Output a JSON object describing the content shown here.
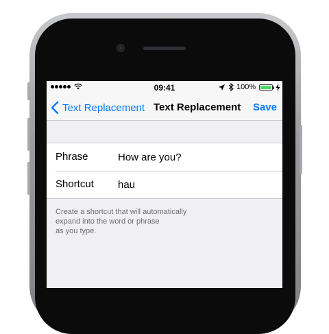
{
  "status_bar": {
    "time": "09:41",
    "battery_percent": "100%",
    "signal_bars": 5,
    "battery_level": 1.0,
    "icons": [
      "signal-dots-icon",
      "wifi-icon",
      "location-arrow-icon",
      "bluetooth-icon",
      "battery-icon",
      "charging-bolt-icon"
    ]
  },
  "nav": {
    "back_label": "Text Replacement",
    "title": "Text Replacement",
    "save_label": "Save",
    "tint_color": "#007aff"
  },
  "form": {
    "phrase": {
      "label": "Phrase",
      "value": "How are you?"
    },
    "shortcut": {
      "label": "Shortcut",
      "value": "hau"
    }
  },
  "footer": {
    "note": "Create a shortcut that will automatically\n expand into the word or phrase\n as you type."
  },
  "colors": {
    "battery_fill": "#4cd964",
    "background": "#efeff4"
  }
}
